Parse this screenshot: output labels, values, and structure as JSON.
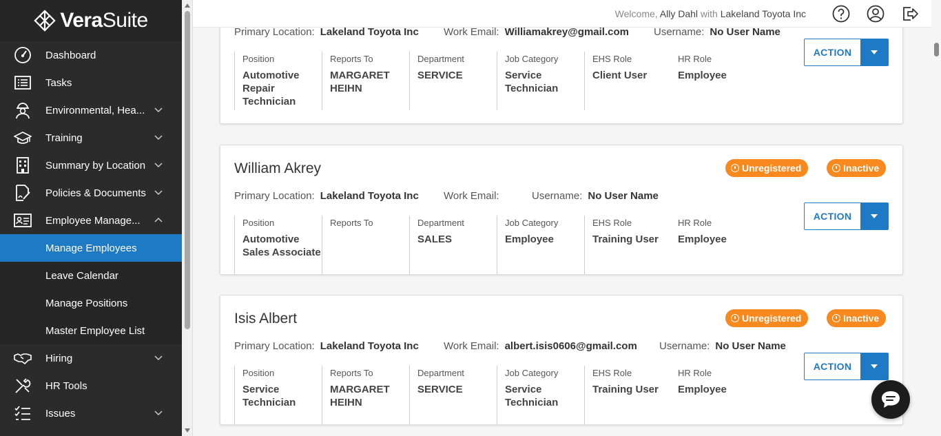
{
  "brand": {
    "name_bold": "Vera",
    "name_light": "Suite"
  },
  "header": {
    "welcome_prefix": "Welcome,",
    "user_name": "Ally Dahl",
    "with_word": "with",
    "company": "Lakeland Toyota Inc",
    "icons": [
      "help-icon",
      "user-profile-icon",
      "logout-icon"
    ]
  },
  "sidebar": {
    "items": [
      {
        "label": "Dashboard",
        "icon": "dashboard-gauge-icon"
      },
      {
        "label": "Tasks",
        "icon": "tasks-list-icon"
      },
      {
        "label": "Environmental, Hea...",
        "icon": "hard-hat-worker-icon"
      },
      {
        "label": "Training",
        "icon": "graduation-cap-icon"
      },
      {
        "label": "Summary by Location",
        "icon": "building-icon"
      },
      {
        "label": "Policies & Documents",
        "icon": "document-pen-icon"
      },
      {
        "label": "Employee Manage...",
        "icon": "id-card-icon"
      },
      {
        "label": "Hiring",
        "icon": "handshake-icon"
      },
      {
        "label": "HR Tools",
        "icon": "tools-icon"
      },
      {
        "label": "Issues",
        "icon": "checklist-icon"
      }
    ],
    "sub_items": [
      {
        "label": "Manage Employees"
      },
      {
        "label": "Leave Calendar"
      },
      {
        "label": "Manage Positions"
      },
      {
        "label": "Master Employee List"
      }
    ]
  },
  "labels": {
    "primary_location": "Primary Location:",
    "work_email": "Work Email:",
    "username": "Username:",
    "position": "Position",
    "reports_to": "Reports To",
    "department": "Department",
    "job_category": "Job Category",
    "ehs_role": "EHS Role",
    "hr_role": "HR Role",
    "action": "ACTION"
  },
  "employees": [
    {
      "name": "",
      "primary_location": "Lakeland Toyota Inc",
      "work_email": "Williamakrey@gmail.com",
      "username": "No User Name",
      "position": "Automotive Repair Technician",
      "reports_to": "MARGARET HEIHN",
      "department": "SERVICE",
      "job_category": "Service Technician",
      "ehs_role": "Client User",
      "hr_role": "Employee"
    },
    {
      "name": "William Akrey",
      "badges": [
        "Unregistered",
        "Inactive"
      ],
      "primary_location": "Lakeland Toyota Inc",
      "work_email": "",
      "username": "No User Name",
      "position": "Automotive Sales Associate",
      "reports_to": "",
      "department": "SALES",
      "job_category": "Employee",
      "ehs_role": "Training User",
      "hr_role": "Employee"
    },
    {
      "name": "Isis Albert",
      "badges": [
        "Unregistered",
        "Inactive"
      ],
      "primary_location": "Lakeland Toyota Inc",
      "work_email": "albert.isis0606@gmail.com",
      "username": "No User Name",
      "position": "Service Technician",
      "reports_to": "MARGARET HEIHN",
      "department": "SERVICE",
      "job_category": "Service Technician",
      "ehs_role": "Training User",
      "hr_role": "Employee"
    }
  ],
  "colors": {
    "sidebar_bg": "#2b2b2b",
    "accent_blue": "#1f7ac5",
    "badge_orange": "#f7891e"
  }
}
